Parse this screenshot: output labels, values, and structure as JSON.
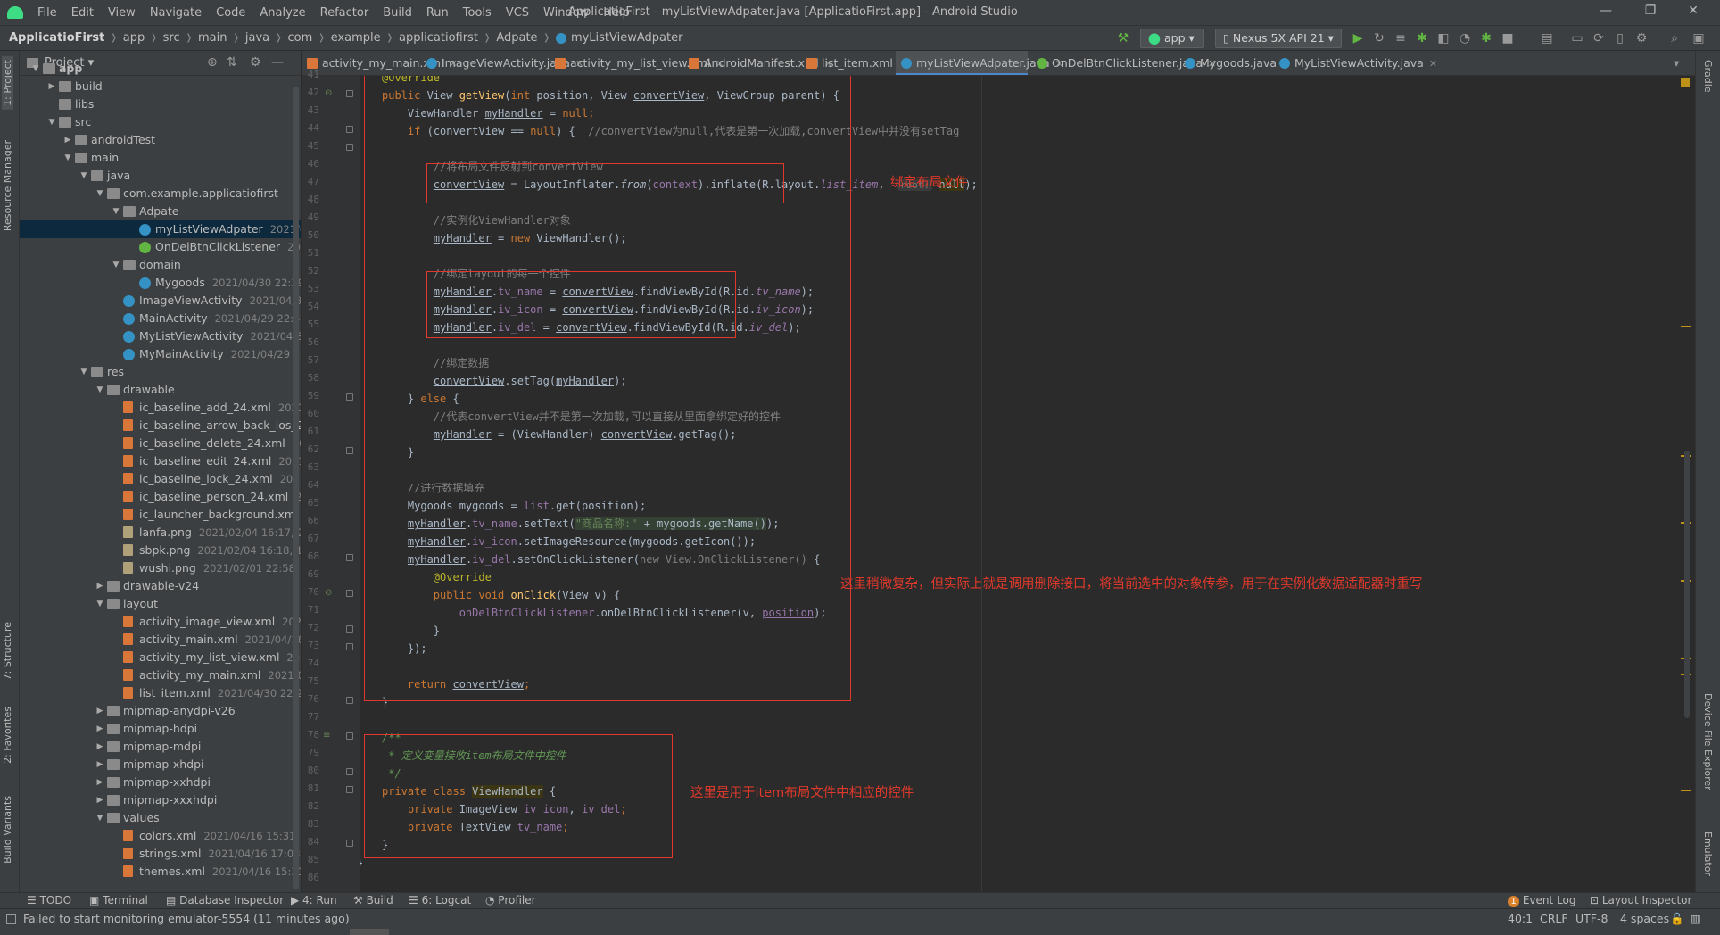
{
  "window": {
    "title": "ApplicatioFirst - myListViewAdpater.java [ApplicatioFirst.app] - Android Studio",
    "controls": [
      "—",
      "❐",
      "✕"
    ]
  },
  "menu": [
    "File",
    "Edit",
    "View",
    "Navigate",
    "Code",
    "Analyze",
    "Refactor",
    "Build",
    "Run",
    "Tools",
    "VCS",
    "Window",
    "Help"
  ],
  "breadcrumb": [
    "ApplicatioFirst",
    "app",
    "src",
    "main",
    "java",
    "com",
    "example",
    "applicatiofirst",
    "Adpate",
    "myListViewAdpater"
  ],
  "toolbar": {
    "run_config": "app",
    "device": "Nexus 5X API 21"
  },
  "project_panel": {
    "title": "Project",
    "tree": [
      {
        "label": "app",
        "indent": 0,
        "icon": "folder",
        "arrow": "▼",
        "bold": true
      },
      {
        "label": "build",
        "indent": 1,
        "icon": "folder",
        "arrow": "▶",
        "meta": ""
      },
      {
        "label": "libs",
        "indent": 1,
        "icon": "folder",
        "arrow": "",
        "meta": ""
      },
      {
        "label": "src",
        "indent": 1,
        "icon": "folder",
        "arrow": "▼",
        "meta": ""
      },
      {
        "label": "androidTest",
        "indent": 2,
        "icon": "folder",
        "arrow": "▶",
        "meta": ""
      },
      {
        "label": "main",
        "indent": 2,
        "icon": "folder",
        "arrow": "▼",
        "meta": ""
      },
      {
        "label": "java",
        "indent": 3,
        "icon": "folder",
        "arrow": "▼",
        "meta": ""
      },
      {
        "label": "com.example.applicatiofirst",
        "indent": 4,
        "icon": "pkg",
        "arrow": "▼",
        "meta": ""
      },
      {
        "label": "Adpate",
        "indent": 5,
        "icon": "pkg",
        "arrow": "▼",
        "meta": ""
      },
      {
        "label": "myListViewAdpater",
        "indent": 6,
        "icon": "cls",
        "arrow": "",
        "meta": "2021/0",
        "selected": true
      },
      {
        "label": "OnDelBtnClickListener",
        "indent": 6,
        "icon": "itf",
        "arrow": "",
        "meta": "202"
      },
      {
        "label": "domain",
        "indent": 5,
        "icon": "pkg",
        "arrow": "▼",
        "meta": ""
      },
      {
        "label": "Mygoods",
        "indent": 6,
        "icon": "cls",
        "arrow": "",
        "meta": "2021/04/30 22:39"
      },
      {
        "label": "ImageViewActivity",
        "indent": 5,
        "icon": "cls",
        "arrow": "",
        "meta": "2021/04/30"
      },
      {
        "label": "MainActivity",
        "indent": 5,
        "icon": "cls",
        "arrow": "",
        "meta": "2021/04/29 22:49"
      },
      {
        "label": "MyListViewActivity",
        "indent": 5,
        "icon": "cls",
        "arrow": "",
        "meta": "2021/04/30"
      },
      {
        "label": "MyMainActivity",
        "indent": 5,
        "icon": "cls",
        "arrow": "",
        "meta": "2021/04/29 23"
      },
      {
        "label": "res",
        "indent": 3,
        "icon": "folder",
        "arrow": "▼",
        "meta": ""
      },
      {
        "label": "drawable",
        "indent": 4,
        "icon": "folder",
        "arrow": "▼",
        "meta": ""
      },
      {
        "label": "ic_baseline_add_24.xml",
        "indent": 5,
        "icon": "xml",
        "arrow": "",
        "meta": "2021/0"
      },
      {
        "label": "ic_baseline_arrow_back_ios_24",
        "indent": 5,
        "icon": "xml",
        "arrow": "",
        "meta": ""
      },
      {
        "label": "ic_baseline_delete_24.xml",
        "indent": 5,
        "icon": "xml",
        "arrow": "",
        "meta": "202"
      },
      {
        "label": "ic_baseline_edit_24.xml",
        "indent": 5,
        "icon": "xml",
        "arrow": "",
        "meta": "2021/0"
      },
      {
        "label": "ic_baseline_lock_24.xml",
        "indent": 5,
        "icon": "xml",
        "arrow": "",
        "meta": "2021/0"
      },
      {
        "label": "ic_baseline_person_24.xml",
        "indent": 5,
        "icon": "xml",
        "arrow": "",
        "meta": "20"
      },
      {
        "label": "ic_launcher_background.xml",
        "indent": 5,
        "icon": "xml",
        "arrow": "",
        "meta": ""
      },
      {
        "label": "lanfa.png",
        "indent": 5,
        "icon": "png",
        "arrow": "",
        "meta": "2021/02/04 16:17, 2"
      },
      {
        "label": "sbpk.png",
        "indent": 5,
        "icon": "png",
        "arrow": "",
        "meta": "2021/02/04 16:18, 1"
      },
      {
        "label": "wushi.png",
        "indent": 5,
        "icon": "png",
        "arrow": "",
        "meta": "2021/02/01 22:58, 2"
      },
      {
        "label": "drawable-v24",
        "indent": 4,
        "icon": "folder",
        "arrow": "▶",
        "meta": ""
      },
      {
        "label": "layout",
        "indent": 4,
        "icon": "folder",
        "arrow": "▼",
        "meta": ""
      },
      {
        "label": "activity_image_view.xml",
        "indent": 5,
        "icon": "xml",
        "arrow": "",
        "meta": "2021/"
      },
      {
        "label": "activity_main.xml",
        "indent": 5,
        "icon": "xml",
        "arrow": "",
        "meta": "2021/04/16 2"
      },
      {
        "label": "activity_my_list_view.xml",
        "indent": 5,
        "icon": "xml",
        "arrow": "",
        "meta": "2021/"
      },
      {
        "label": "activity_my_main.xml",
        "indent": 5,
        "icon": "xml",
        "arrow": "",
        "meta": "2021/04/"
      },
      {
        "label": "list_item.xml",
        "indent": 5,
        "icon": "xml",
        "arrow": "",
        "meta": "2021/04/30 22:27,"
      },
      {
        "label": "mipmap-anydpi-v26",
        "indent": 4,
        "icon": "folder",
        "arrow": "▶",
        "meta": ""
      },
      {
        "label": "mipmap-hdpi",
        "indent": 4,
        "icon": "folder",
        "arrow": "▶",
        "meta": ""
      },
      {
        "label": "mipmap-mdpi",
        "indent": 4,
        "icon": "folder",
        "arrow": "▶",
        "meta": ""
      },
      {
        "label": "mipmap-xhdpi",
        "indent": 4,
        "icon": "folder",
        "arrow": "▶",
        "meta": ""
      },
      {
        "label": "mipmap-xxhdpi",
        "indent": 4,
        "icon": "folder",
        "arrow": "▶",
        "meta": ""
      },
      {
        "label": "mipmap-xxxhdpi",
        "indent": 4,
        "icon": "folder",
        "arrow": "▶",
        "meta": ""
      },
      {
        "label": "values",
        "indent": 4,
        "icon": "folder",
        "arrow": "▼",
        "meta": ""
      },
      {
        "label": "colors.xml",
        "indent": 5,
        "icon": "xml",
        "arrow": "",
        "meta": "2021/04/16 15:31, 38"
      },
      {
        "label": "strings.xml",
        "indent": 5,
        "icon": "xml",
        "arrow": "",
        "meta": "2021/04/16 17:03, 1"
      },
      {
        "label": "themes.xml",
        "indent": 5,
        "icon": "xml",
        "arrow": "",
        "meta": "2021/04/16 15:31, 8"
      }
    ]
  },
  "left_strip_tabs": [
    "1: Project",
    "Resource Manager",
    "7: Structure",
    "2: Favorites",
    "Build Variants"
  ],
  "right_strip_tabs": [
    "Gradle",
    "Device File Explorer",
    "Emulator"
  ],
  "editor_tabs": [
    {
      "label": "activity_my_main.xml",
      "type": "xml"
    },
    {
      "label": "ImageViewActivity.java",
      "type": "cls"
    },
    {
      "label": "activity_my_list_view.xml",
      "type": "xml"
    },
    {
      "label": "AndroidManifest.xml",
      "type": "xml"
    },
    {
      "label": "list_item.xml",
      "type": "xml"
    },
    {
      "label": "myListViewAdpater.java",
      "type": "cls",
      "active": true
    },
    {
      "label": "OnDelBtnClickListener.java",
      "type": "itf"
    },
    {
      "label": "Mygoods.java",
      "type": "cls"
    },
    {
      "label": "MyListViewActivity.java",
      "type": "cls"
    }
  ],
  "line_numbers": [
    "41",
    "42",
    "43",
    "44",
    "45",
    "46",
    "47",
    "48",
    "49",
    "50",
    "51",
    "52",
    "53",
    "54",
    "55",
    "56",
    "57",
    "58",
    "59",
    "60",
    "61",
    "62",
    "63",
    "64",
    "65",
    "66",
    "67",
    "68",
    "69",
    "70",
    "71",
    "72",
    "73",
    "74",
    "75",
    "76",
    "77",
    "78",
    "79",
    "80",
    "81",
    "82",
    "83",
    "84",
    "85",
    "86"
  ],
  "code": {
    "l41": "@Override",
    "l42a": "public ",
    "l42b": "View ",
    "l42c": "getView",
    "l42d": "(",
    "l42e": "int ",
    "l42f": "position, View ",
    "l42g": "convertView",
    "l42h": ", ViewGroup parent) {",
    "l43a": "    ViewHandler ",
    "l43b": "myHandler",
    "l43c": " = ",
    "l43d": "null",
    "l43e": ";",
    "l44a": "    ",
    "l44b": "if ",
    "l44c": "(convertView == ",
    "l44d": "null",
    "l44e": ") {  ",
    "l44f": "//convertView为null,代表是第一次加载,convertView中并没有setTag",
    "l46": "        //将布局文件反射到convertView",
    "l47a": "        ",
    "l47b": "convertView",
    "l47c": " = LayoutInflater.",
    "l47d": "from",
    "l47e": "(",
    "l47f": "context",
    "l47g": ").inflate(R.layout.",
    "l47h": "list_item",
    "l47i": ",  ",
    "l47j": "root:",
    "l47k": " ",
    "l47l": "null",
    "l47m": ");",
    "l49": "        //实例化ViewHandler对象",
    "l50a": "        ",
    "l50b": "myHandler",
    "l50c": " = ",
    "l50d": "new ",
    "l50e": "ViewHandler();",
    "l52": "        //绑定layout的每一个控件",
    "l53a": "        ",
    "l53b": "myHandler",
    "l53c": ".",
    "l53d": "tv_name",
    "l53e": " = ",
    "l53f": "convertView",
    "l53g": ".findViewById(R.id.",
    "l53h": "tv_name",
    "l53i": ");",
    "l54a": "        ",
    "l54b": "myHandler",
    "l54c": ".",
    "l54d": "iv_icon",
    "l54e": " = ",
    "l54f": "convertView",
    "l54g": ".findViewById(R.id.",
    "l54h": "iv_icon",
    "l54i": ");",
    "l55a": "        ",
    "l55b": "myHandler",
    "l55c": ".",
    "l55d": "iv_del",
    "l55e": " = ",
    "l55f": "convertView",
    "l55g": ".findViewById(R.id.",
    "l55h": "iv_del",
    "l55i": ");",
    "l57": "        //绑定数据",
    "l58a": "        ",
    "l58b": "convertView",
    "l58c": ".setTag(",
    "l58d": "myHandler",
    "l58e": ");",
    "l59a": "    } ",
    "l59b": "else ",
    "l59c": "{",
    "l60": "        //代表convertView并不是第一次加载,可以直接从里面拿绑定好的控件",
    "l61a": "        ",
    "l61b": "myHandler",
    "l61c": " = (ViewHandler) ",
    "l61d": "convertView",
    "l61e": ".getTag();",
    "l62": "    }",
    "l64": "    //进行数据填充",
    "l65a": "    Mygoods mygoods = ",
    "l65b": "list",
    "l65c": ".get(position);",
    "l66a": "    ",
    "l66b": "myHandler",
    "l66c": ".",
    "l66d": "tv_name",
    "l66e": ".setText(",
    "l66f": "\"商品名称:\"",
    "l66g": " + mygoods.getName()",
    "l66h": ");",
    "l67a": "    ",
    "l67b": "myHandler",
    "l67c": ".",
    "l67d": "iv_icon",
    "l67e": ".setImageResource(mygoods.getIcon());",
    "l68a": "    ",
    "l68b": "myHandler",
    "l68c": ".",
    "l68d": "iv_del",
    "l68e": ".setOnClickListener(",
    "l68f": "new View.OnClickListener() ",
    "l68g": "{",
    "l69": "        @Override",
    "l70a": "        ",
    "l70b": "public void ",
    "l70c": "onClick",
    "l70d": "(View v) {",
    "l71a": "            ",
    "l71b": "onDelBtnClickListener",
    "l71c": ".onDelBtnClickListener(v, ",
    "l71d": "position",
    "l71e": ");",
    "l72": "        }",
    "l73": "    });",
    "l75a": "    ",
    "l75b": "return ",
    "l75c": "convertView",
    "l75d": ";",
    "l76": "}",
    "l78": "/**",
    "l79": " * 定义变量接收item布局文件中控件",
    "l80": " */",
    "l81a": "private class ",
    "l81b": "ViewHandler",
    "l81c": " {",
    "l82a": "    ",
    "l82b": "private ",
    "l82c": "ImageView ",
    "l82d": "iv_icon",
    "l82e": ", ",
    "l82f": "iv_del",
    "l82g": ";",
    "l83a": "    ",
    "l83b": "private ",
    "l83c": "TextView ",
    "l83d": "tv_name",
    "l83e": ";",
    "l84": "}",
    "l85": "}"
  },
  "annotations": {
    "bind_layout": "绑定布局文件",
    "delete_note": "这里稍微复杂，但实际上就是调用删除接口，将当前选中的对象传参，用于在实例化数据适配器时重写",
    "item_controls": "这里是用于item布局文件中相应的控件"
  },
  "bottom_tools": [
    "TODO",
    "Terminal",
    "Database Inspector",
    "4: Run",
    "Build",
    "6: Logcat",
    "Profiler",
    "Event Log",
    "Layout Inspector"
  ],
  "event_log_count": "1",
  "status": {
    "message": "Failed to start monitoring emulator-5554 (11 minutes ago)",
    "position": "40:1",
    "line_sep": "CRLF",
    "encoding": "UTF-8",
    "indent": "4 spaces"
  },
  "colors": {
    "accent": "#4a88c7",
    "annotation_red": "#e0392b",
    "editor_bg": "#2b2b2b",
    "panel_bg": "#3c3f41"
  }
}
